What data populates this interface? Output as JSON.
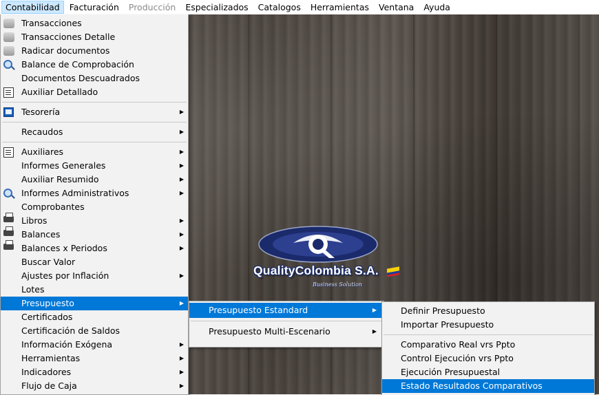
{
  "menubar": {
    "items": [
      {
        "label": "Contabilidad",
        "active": true,
        "disabled": false
      },
      {
        "label": "Facturación",
        "active": false,
        "disabled": false
      },
      {
        "label": "Producción",
        "active": false,
        "disabled": true
      },
      {
        "label": "Especializados",
        "active": false,
        "disabled": false
      },
      {
        "label": "Catalogos",
        "active": false,
        "disabled": false
      },
      {
        "label": "Herramientas",
        "active": false,
        "disabled": false
      },
      {
        "label": "Ventana",
        "active": false,
        "disabled": false
      },
      {
        "label": "Ayuda",
        "active": false,
        "disabled": false
      }
    ]
  },
  "main_menu": {
    "items": [
      "Transacciones",
      "Transacciones Detalle",
      "Radicar documentos",
      "Balance de Comprobación",
      "Documentos Descuadrados",
      "Auxiliar Detallado",
      "Tesorería",
      "Recaudos",
      "Auxiliares",
      "Informes Generales",
      "Auxiliar Resumido",
      "Informes Administrativos",
      "Comprobantes",
      "Libros",
      "Balances",
      "Balances x Periodos",
      "Buscar Valor",
      "Ajustes por Inflación",
      "Lotes",
      "Presupuesto",
      "Certificados",
      "Certificación de Saldos",
      "Información Exógena",
      "Herramientas",
      "Indicadores",
      "Flujo de Caja"
    ]
  },
  "submenu_presupuesto": {
    "items": [
      "Presupuesto  Estandard",
      "Presupuesto Multi-Escenario"
    ]
  },
  "submenu_estandard": {
    "items": [
      "Definir Presupuesto",
      "Importar Presupuesto",
      "Comparativo  Real vrs Ppto",
      "Control Ejecución vrs Ppto",
      "Ejecución Presupuestal",
      "Estado Resultados Comparativos"
    ]
  },
  "logo": {
    "name": "QualityColombia S.A.",
    "tagline": "Business Solution"
  },
  "colors": {
    "highlight": "#0078d7",
    "menu_bg": "#f2f2f2",
    "menubar_active": "#cce8ff"
  }
}
